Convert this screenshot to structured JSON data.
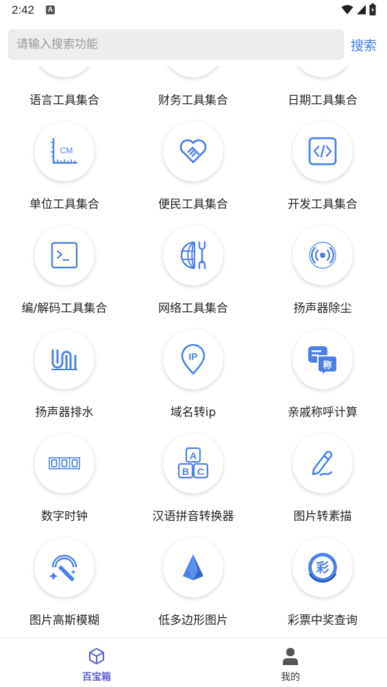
{
  "status_bar": {
    "time": "2:42",
    "notification_badge": "A"
  },
  "search": {
    "placeholder": "请输入搜索功能",
    "button_label": "搜索"
  },
  "tools": [
    {
      "label": "语言工具集合",
      "icon": "language-icon"
    },
    {
      "label": "财务工具集合",
      "icon": "finance-icon"
    },
    {
      "label": "日期工具集合",
      "icon": "calendar-icon"
    },
    {
      "label": "单位工具集合",
      "icon": "ruler-cm-icon"
    },
    {
      "label": "便民工具集合",
      "icon": "heart-handshake-icon"
    },
    {
      "label": "开发工具集合",
      "icon": "code-icon"
    },
    {
      "label": "编/解码工具集合",
      "icon": "terminal-icon"
    },
    {
      "label": "网络工具集合",
      "icon": "globe-wrench-icon"
    },
    {
      "label": "扬声器除尘",
      "icon": "speaker-wave-icon"
    },
    {
      "label": "扬声器排水",
      "icon": "drain-icon"
    },
    {
      "label": "域名转ip",
      "icon": "ip-pin-icon"
    },
    {
      "label": "亲戚称呼计算",
      "icon": "chat-title-icon"
    },
    {
      "label": "数字时钟",
      "icon": "digital-clock-icon"
    },
    {
      "label": "汉语拼音转换器",
      "icon": "abc-blocks-icon"
    },
    {
      "label": "图片转素描",
      "icon": "pen-sketch-icon"
    },
    {
      "label": "图片高斯模糊",
      "icon": "magic-wand-icon"
    },
    {
      "label": "低多边形图片",
      "icon": "low-poly-icon"
    },
    {
      "label": "彩票中奖查询",
      "icon": "lottery-icon"
    }
  ],
  "icon_glyphs": {
    "cm": "CM",
    "ip": "IP",
    "a": "A",
    "b": "B",
    "c": "C",
    "digits": "000",
    "cheng": "称",
    "cai": "彩"
  },
  "bottom_nav": {
    "items": [
      {
        "label": "百宝箱",
        "icon": "box-icon",
        "active": true
      },
      {
        "label": "我的",
        "icon": "user-icon",
        "active": false
      }
    ]
  },
  "colors": {
    "accent": "#4a80e8",
    "nav_active": "#5b5bd6",
    "nav_inactive": "#555555"
  }
}
